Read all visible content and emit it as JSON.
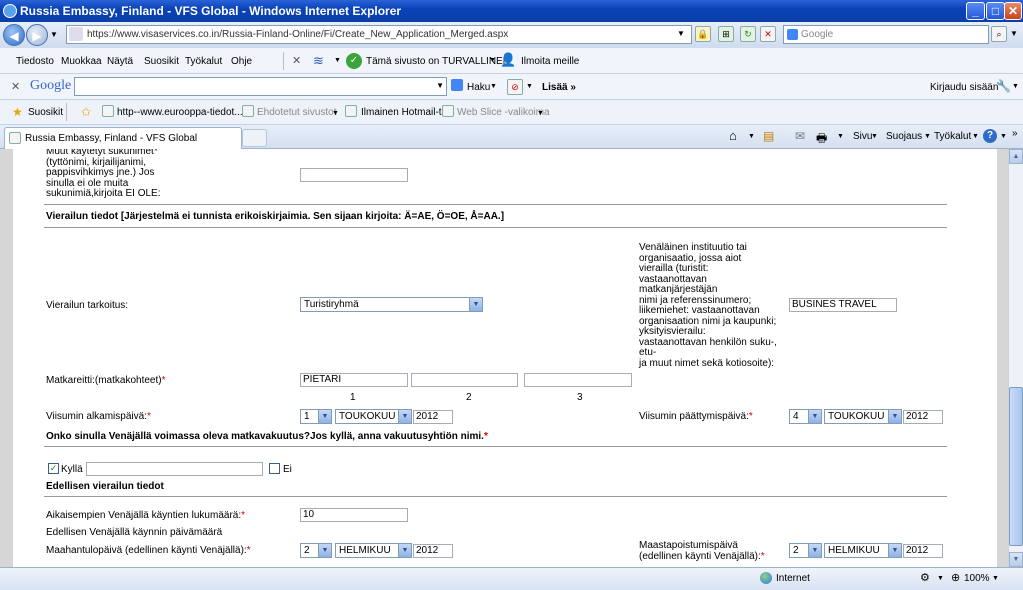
{
  "window": {
    "title": "Russia Embassy, Finland - VFS Global - Windows Internet Explorer",
    "minimize": "_",
    "maximize": "□",
    "close": "✕"
  },
  "address": {
    "url": "https://www.visaservices.co.in/Russia-Finland-Online/Fi/Create_New_Application_Merged.aspx",
    "search_placeholder": "Google"
  },
  "menu": {
    "items": [
      "Tiedosto",
      "Muokkaa",
      "Näytä",
      "Suosikit",
      "Työkalut",
      "Ohje"
    ],
    "safety_label": "Tämä sivusto on TURVALLINEN",
    "report_label": "Ilmoita meille"
  },
  "google_toolbar": {
    "brand": "Google",
    "search_label": "Haku",
    "more_label": "Lisää »",
    "signin_label": "Kirjaudu sisään"
  },
  "favorites": {
    "label": "Suosikit",
    "items": [
      "http--www.eurooppa-tiedot...",
      "Ehdotetut sivustot",
      "Ilmainen Hotmail-tili",
      "Web Slice -valikoima"
    ]
  },
  "tab": {
    "label": "Russia Embassy, Finland - VFS Global"
  },
  "command_bar": {
    "page": "Sivu",
    "safety": "Suojaus",
    "tools": "Työkalut"
  },
  "form": {
    "other_surnames_label": "Muut käytetyt sukunimet*\n(tyttönimi, kirjailijanimi,\npappisvihkimys jne.) Jos\nsinulla ei ole muita\nsukunimiä,kirjoita EI OLE:",
    "visit_header": "Vierailun tiedot [Järjestelmä ei tunnista erikoiskirjaimia. Sen sijaan kirjoita: Ä=AE, Ö=OE, Å=AA.]",
    "purpose_label": "Vierailun tarkoitus:",
    "purpose_value": "Turistiryhmä",
    "org_label": "Venäläinen instituutio tai\norganisaatio, jossa aiot\nvierailla (turistit:\nvastaanottavan\nmatkanjärjestäjän\nnimi ja referenssinumero;\nliikemiehet: vastaanottavan\norganisaation nimi ja kaupunki;\nyksityisvierailu:\nvastaanottavan henkilön suku-,\netu-\nja muut nimet sekä kotiosoite):",
    "org_value": "BUSINES TRAVEL",
    "route_label": "Matkareitti:(matkakohteet)",
    "route_values": [
      "PIETARI",
      "",
      ""
    ],
    "route_numbers": [
      "1",
      "2",
      "3"
    ],
    "visa_start_label": "Viisumin alkamispäivä:",
    "visa_start": {
      "day": "1",
      "month": "TOUKOKUU",
      "year": "2012"
    },
    "visa_end_label": "Viisumin päättymispäivä:",
    "visa_end": {
      "day": "4",
      "month": "TOUKOKUU",
      "year": "2012"
    },
    "insurance_question": "Onko sinulla Venäjällä voimassa oleva matkavakuutus?Jos kyllä, anna vakuutusyhtiön nimi.",
    "yes_label": "Kyllä",
    "no_label": "Ei",
    "prev_header": "Edellisen vierailun tiedot",
    "prev_visits_label": "Aikaisempien Venäjällä käyntien lukumäärä:",
    "prev_visits_value": "10",
    "prev_date_label": "Edellisen Venäjällä käynnin päivämäärä",
    "entry_label": "Maahantulopäivä (edellinen käynti Venäjällä):",
    "entry": {
      "day": "2",
      "month": "HELMIKUU",
      "year": "2012"
    },
    "exit_label": "Maastapoistumispäivä\n(edellinen käynti Venäjällä):",
    "exit": {
      "day": "2",
      "month": "HELMIKUU",
      "year": "2012"
    }
  },
  "status": {
    "zone": "Internet",
    "zoom": "100%"
  }
}
